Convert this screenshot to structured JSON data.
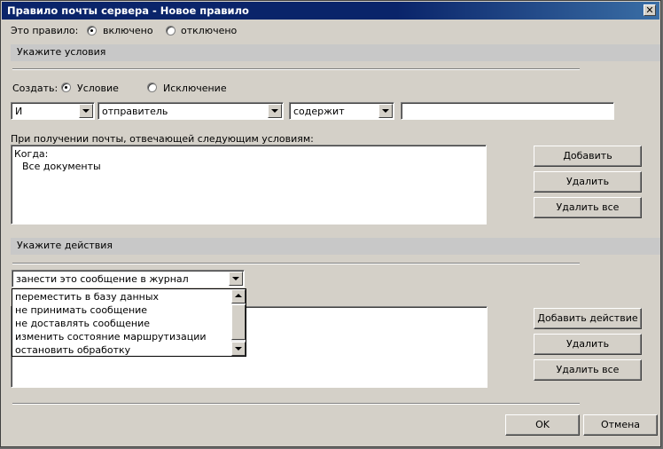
{
  "dialog": {
    "title": "Правило почты сервера - Новое правило",
    "close_glyph": "✕"
  },
  "rule_state": {
    "label": "Это правило:",
    "enabled_label": "включено",
    "disabled_label": "отключено",
    "selected": "enabled"
  },
  "conditions": {
    "section_title": "Укажите условия",
    "create_label": "Создать:",
    "condition_label": "Условие",
    "exception_label": "Исключение",
    "selected": "condition",
    "operator_value": "И",
    "field_value": "отправитель",
    "match_value": "содержит",
    "text_value": "",
    "list_caption": "При получении почты, отвечающей следующим условиям:",
    "list_lines": [
      "Когда:",
      "Все документы"
    ],
    "add_button": "Добавить",
    "delete_button": "Удалить",
    "delete_all_button": "Удалить все"
  },
  "actions": {
    "section_title": "Укажите действия",
    "action_value": "занести это сообщение в журнал",
    "dropdown_options": [
      "переместить в базу данных",
      "не принимать сообщение",
      "не доставлять сообщение",
      "изменить состояние маршрутизации",
      "остановить обработку"
    ],
    "add_action_button": "Добавить действие",
    "delete_button": "Удалить",
    "delete_all_button": "Удалить все"
  },
  "footer": {
    "ok_button": "OK",
    "cancel_button": "Отмена"
  }
}
